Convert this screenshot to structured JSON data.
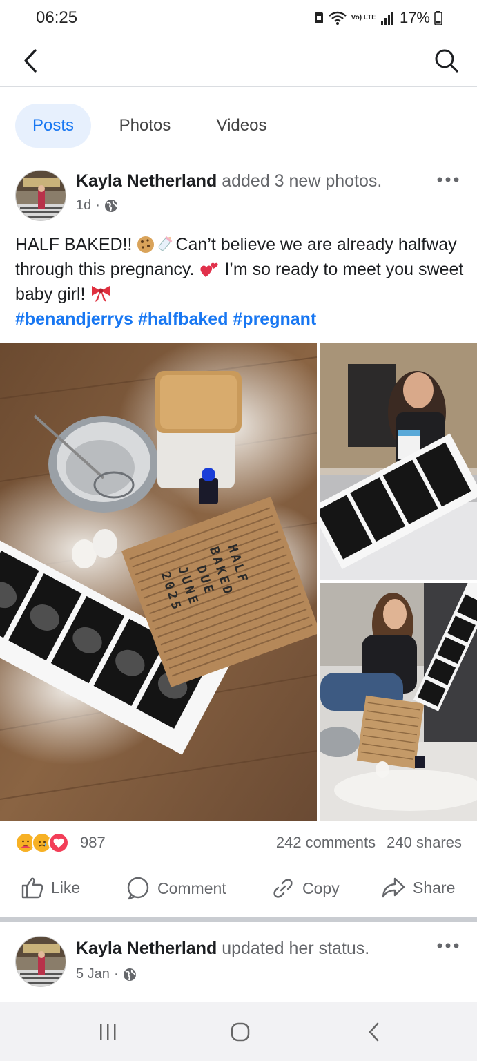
{
  "status_bar": {
    "time": "06:25",
    "battery": "17%",
    "network_label": "Vo) LTE"
  },
  "nav": {
    "back_icon": "chevron-left-icon",
    "search_icon": "search-icon"
  },
  "tabs": [
    {
      "label": "Posts",
      "active": true
    },
    {
      "label": "Photos",
      "active": false
    },
    {
      "label": "Videos",
      "active": false
    }
  ],
  "post": {
    "author": "Kayla Netherland",
    "action": "added 3 new photos.",
    "time": "1d",
    "visibility_icon": "globe-icon",
    "text_line1": "HALF BAKED!! ",
    "text_line1b": "Can’t believe we are already halfway through this pregnancy. ",
    "text_line2": " I’m so ready to meet you sweet baby girl! ",
    "hashtags": "#benandjerrys #halfbaked #pregnant",
    "letterboard": [
      "HALF",
      "BAKED",
      "DUE",
      "JUNE",
      "2025"
    ],
    "reactions_count": "987",
    "comments": "242 comments",
    "shares": "240 shares",
    "actions": {
      "like": "Like",
      "comment": "Comment",
      "copy": "Copy",
      "share": "Share"
    }
  },
  "post2": {
    "author": "Kayla Netherland",
    "action": "updated her status.",
    "time": "5 Jan"
  },
  "colors": {
    "accent": "#1877f2",
    "tab_active_bg": "#e7f0fd",
    "muted": "#65676b"
  }
}
